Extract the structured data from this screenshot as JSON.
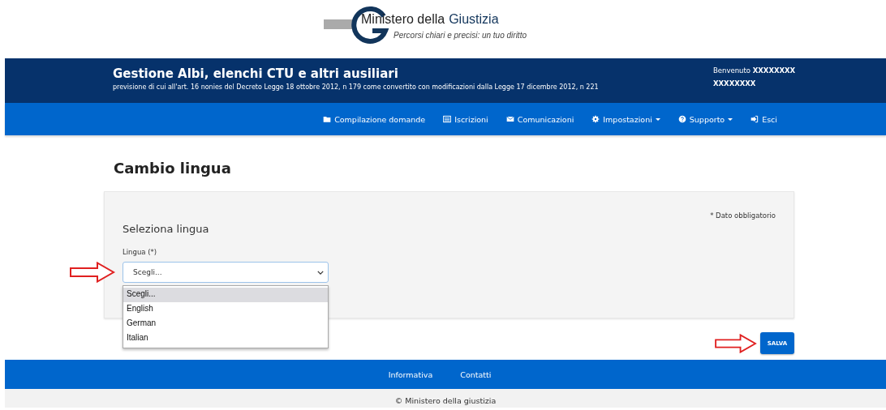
{
  "logo": {
    "name": "Ministero della",
    "name_highlight": "Giustizia",
    "tagline": "Percorsi chiari e precisi: un tuo diritto"
  },
  "header": {
    "title": "Gestione Albi, elenchi CTU e altri ausiliari",
    "subtitle": "previsione di cui all'art. 16 nonies del Decreto Legge 18 ottobre 2012, n 179 come convertito con modificazioni dalla Legge 17 dicembre 2012, n 221",
    "welcome": "Benvenuto **XXXXXXXX XXXXXXXX**"
  },
  "nav": [
    {
      "label": "Compilazione domande",
      "kind": "folder",
      "dropdown": false
    },
    {
      "label": "Iscrizioni",
      "kind": "list",
      "dropdown": false
    },
    {
      "label": "Comunicazioni",
      "kind": "envelope",
      "dropdown": false
    },
    {
      "label": "Impostazioni",
      "kind": "gear",
      "dropdown": true
    },
    {
      "label": "Supporto",
      "kind": "question",
      "dropdown": true
    },
    {
      "label": "Esci",
      "kind": "exit",
      "dropdown": false
    }
  ],
  "page_title": "Cambio lingua",
  "form": {
    "required_note": "* Dato obbligatorio",
    "section_title": "Seleziona lingua",
    "field_label": "Lingua (*)",
    "value": "Scegli...",
    "expanded": true,
    "options": [
      {
        "label": "Scegli...",
        "selected": true
      },
      {
        "label": "English",
        "selected": false
      },
      {
        "label": "German",
        "selected": false
      },
      {
        "label": "Italian",
        "selected": false
      }
    ]
  },
  "save_button": "SALVA",
  "footer": {
    "links": [
      "Informativa",
      "Contatti"
    ],
    "copyright": "© Ministero della giustizia"
  }
}
